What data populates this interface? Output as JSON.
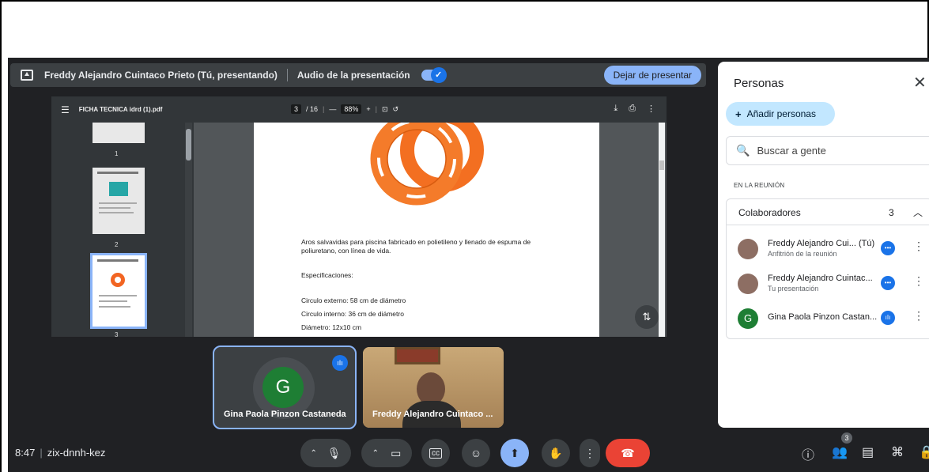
{
  "presenting_bar": {
    "presenter": "Freddy Alejandro Cuintaco Prieto (Tú, presentando)",
    "audio_label": "Audio de la presentación",
    "stop_label": "Dejar de presentar"
  },
  "pdf_viewer": {
    "file_name": "FICHA TECNICA idrd (1).pdf",
    "page_current": "3",
    "page_total": "/ 16",
    "zoom": "88%",
    "minus": "—",
    "plus": "+",
    "thumbnails": [
      "1",
      "2",
      "3"
    ],
    "page_text": {
      "description": "Aros salvavidas para piscina fabricado en polietileno y llenado de espuma de poliuretano, con línea de vida.",
      "specs_title": "Especificaciones:",
      "spec_1": "Circulo externo: 58 cm de diámetro",
      "spec_2": "Circulo interno: 36 cm de diámetro",
      "spec_3": "Diámetro: 12x10 cm"
    }
  },
  "tiles": [
    {
      "name": "Gina Paola Pinzon Castaneda",
      "initial": "G",
      "active": true
    },
    {
      "name": "Freddy Alejandro Cuintaco ..."
    }
  ],
  "bottom_bar": {
    "time": "8:47",
    "meeting_code": "zix-dnnh-kez",
    "people_count": "3"
  },
  "people_panel": {
    "title": "Personas",
    "add_label": "Añadir personas",
    "search_placeholder": "Buscar a gente",
    "section_label": "EN LA REUNIÓN",
    "group_label": "Colaboradores",
    "group_count": "3",
    "participants": [
      {
        "name": "Freddy Alejandro Cui... (Tú)",
        "sub": "Anfitrión de la reunión"
      },
      {
        "name": "Freddy Alejandro Cuintac...",
        "sub": "Tu presentación"
      },
      {
        "name": "Gina Paola Pinzon Castan...",
        "sub": "",
        "initial": "G"
      }
    ]
  },
  "colors": {
    "background": "#202124",
    "accent": "#8ab4f8",
    "end_call": "#ea4335",
    "avatar_green": "#1e7e34"
  }
}
